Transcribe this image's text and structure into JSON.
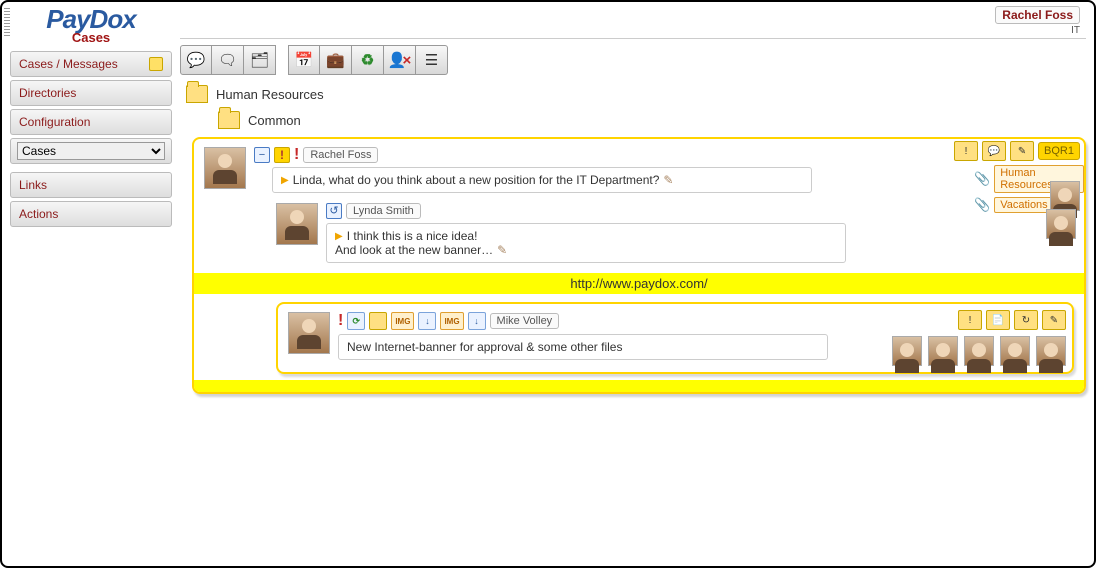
{
  "brand": {
    "name": "PayDox",
    "section": "Cases"
  },
  "user": {
    "name": "Rachel Foss",
    "dept": "IT"
  },
  "nav": {
    "cases_messages": "Cases / Messages",
    "directories": "Directories",
    "configuration": "Configuration",
    "select_value": "Cases",
    "links": "Links",
    "actions": "Actions"
  },
  "toolbar": {
    "new_msg_icon": "💬",
    "new_topic_icon": "🗨",
    "new_topic2_icon": "🗂",
    "cal_icon": "📅",
    "case_icon": "💼",
    "refresh_icon": "♻",
    "user_del_icon": "👤",
    "list_icon": "☰"
  },
  "folders": {
    "root": "Human Resources",
    "sub": "Common"
  },
  "case": {
    "code": "BQR1",
    "tags": {
      "t1": "Human Resources",
      "t2": "Vacations"
    },
    "posts": [
      {
        "author": "Rachel Foss",
        "text": "Linda, what do you think about a new position for the IT Department?"
      },
      {
        "author": "Lynda Smith",
        "line1": "I think this is a nice idea!",
        "line2": "And look at the new banner…"
      }
    ],
    "link": "http://www.paydox.com/",
    "nested": {
      "author": "Mike Volley",
      "text": "New Internet-banner for approval & some other files"
    }
  }
}
